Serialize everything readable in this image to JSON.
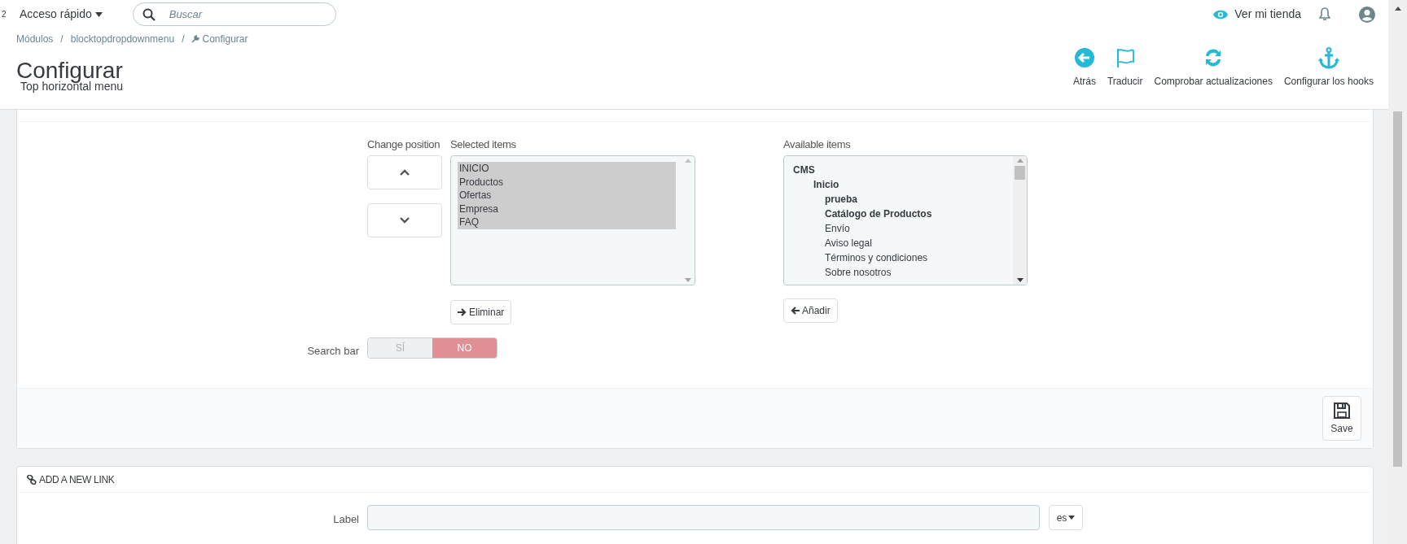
{
  "topbar": {
    "counter": "2",
    "quick_access": "Acceso rápido",
    "search": {
      "placeholder": "Buscar"
    },
    "view_store": "Ver mi tienda"
  },
  "breadcrumb": [
    {
      "label": "Módulos",
      "separator": "/"
    },
    {
      "label": "blocktopdropdownmenu",
      "separator": "/"
    },
    {
      "label": "Configurar"
    }
  ],
  "page": {
    "title": "Configurar",
    "subtitle": "Top horizontal menu"
  },
  "toolbar": [
    {
      "kind": "back",
      "label": "Atrás"
    },
    {
      "kind": "translate",
      "label": "Traducir"
    },
    {
      "kind": "refresh",
      "label": "Comprobar actualizaciones"
    },
    {
      "kind": "hooks",
      "label": "Configurar los hooks"
    }
  ],
  "menu_panel": {
    "change_position": "Change position",
    "selected_items": {
      "label": "Selected items",
      "items": [
        {
          "label": "INICIO",
          "selected": true
        },
        {
          "label": "Productos",
          "selected": true
        },
        {
          "label": "Ofertas",
          "selected": true
        },
        {
          "label": "Empresa",
          "selected": true
        },
        {
          "label": "FAQ",
          "selected": true
        }
      ]
    },
    "remove_button": "Eliminar",
    "available_items": {
      "label": "Available items",
      "items": [
        {
          "label": "CMS",
          "kind": "category",
          "children": [
            {
              "label": "Inicio",
              "kind": "category",
              "children": [
                {
                  "label": "prueba",
                  "kind": "category"
                },
                {
                  "label": "Catálogo de Productos",
                  "kind": "category"
                },
                {
                  "label": "Envío",
                  "kind": "page"
                },
                {
                  "label": "Aviso legal",
                  "kind": "page"
                },
                {
                  "label": "Términos y condiciones",
                  "kind": "page"
                },
                {
                  "label": "Sobre nosotros",
                  "kind": "page"
                }
              ]
            }
          ]
        }
      ]
    },
    "add_button": "Añadir",
    "search_bar": {
      "label": "Search bar",
      "options": [
        {
          "label": "SÍ",
          "selected": false
        },
        {
          "label": "NO",
          "selected": true
        }
      ]
    },
    "save_button": "Save"
  },
  "link_panel": {
    "title": "ADD A NEW LINK",
    "label_field": {
      "label": "Label",
      "language": "es"
    }
  }
}
